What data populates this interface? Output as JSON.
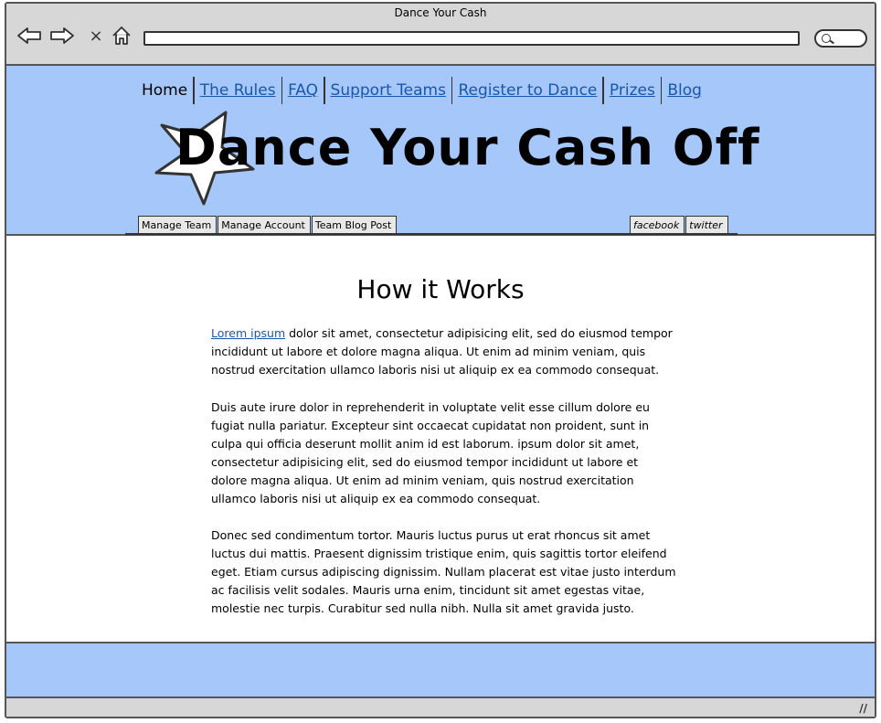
{
  "browser": {
    "window_title": "Dance Your Cash",
    "back_glyph": "⇦",
    "forward_glyph": "⇨",
    "stop_glyph": "×",
    "home_glyph": "⌂",
    "address": ""
  },
  "header": {
    "nav": [
      {
        "label": "Home",
        "active": true
      },
      {
        "label": "The Rules",
        "active": false
      },
      {
        "label": "FAQ",
        "active": false
      },
      {
        "label": "Support Teams",
        "active": false
      },
      {
        "label": "Register to Dance",
        "active": false
      },
      {
        "label": "Prizes",
        "active": false
      },
      {
        "label": "Blog",
        "active": false
      }
    ],
    "site_title": "Dance Your Cash Off",
    "tabs_left": [
      "Manage Team",
      "Manage Account",
      "Team Blog Post"
    ],
    "tabs_right": [
      "facebook",
      "twitter"
    ]
  },
  "content": {
    "heading": "How it Works",
    "p1_link": "Lorem ipsum",
    "p1_text": " dolor sit amet, consectetur adipisicing elit, sed do eiusmod tempor incididunt ut labore et dolore magna aliqua. Ut enim ad minim veniam, quis nostrud exercitation ullamco laboris nisi ut aliquip ex ea commodo consequat.",
    "p2_text": "Duis aute irure dolor in reprehenderit in voluptate velit esse cillum dolore eu fugiat nulla pariatur. Excepteur sint occaecat cupidatat non proident, sunt in culpa qui officia deserunt mollit anim id est laborum. ipsum dolor sit amet, consectetur adipisicing elit, sed do eiusmod tempor incididunt ut labore et dolore magna aliqua. Ut enim ad minim veniam, quis nostrud exercitation ullamco laboris nisi ut aliquip ex ea commodo consequat.",
    "p3_text": "Donec sed condimentum tortor. Mauris luctus purus ut erat rhoncus sit amet luctus dui mattis. Praesent dignissim tristique enim, quis sagittis tortor eleifend eget. Etiam cursus adipiscing dignissim. Nullam placerat est vitae justo interdum ac facilisis velit sodales. Mauris urna enim, tincidunt sit amet egestas vitae, molestie nec turpis. Curabitur sed nulla nibh. Nulla sit amet gravida justo."
  },
  "status": {
    "grip_glyph": "//"
  },
  "colors": {
    "header_bg": "#a6c7fa",
    "link": "#1a57a8",
    "chrome": "#d7d7d7"
  }
}
